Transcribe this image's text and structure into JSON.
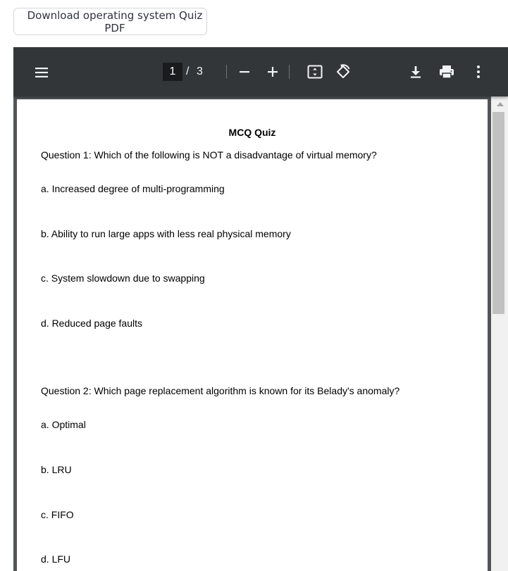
{
  "download_button": {
    "label": "Download operating system Quiz PDF"
  },
  "viewer": {
    "toolbar": {
      "menu_icon": "hamburger-menu-icon",
      "current_page": "1",
      "page_separator": "/",
      "total_pages": "3",
      "zoom_out_icon": "minus-icon",
      "zoom_in_icon": "plus-icon",
      "fit_icon": "fit-to-page-icon",
      "rotate_icon": "rotate-counterclockwise-icon",
      "download_icon": "download-icon",
      "print_icon": "print-icon",
      "more_icon": "vertical-dots-icon"
    },
    "document": {
      "title": "MCQ Quiz",
      "questions": [
        {
          "text": "Question 1: Which of the following is NOT a disadvantage of virtual memory?",
          "options": [
            "a. Increased degree of multi-programming",
            "b. Ability to run large apps with less real physical memory",
            "c. System slowdown due to swapping",
            "d. Reduced page faults"
          ]
        },
        {
          "text": "Question 2: Which page replacement algorithm is known for its Belady's anomaly?",
          "options": [
            "a. Optimal",
            "b. LRU",
            "c. FIFO",
            "d. LFU"
          ]
        }
      ]
    }
  }
}
